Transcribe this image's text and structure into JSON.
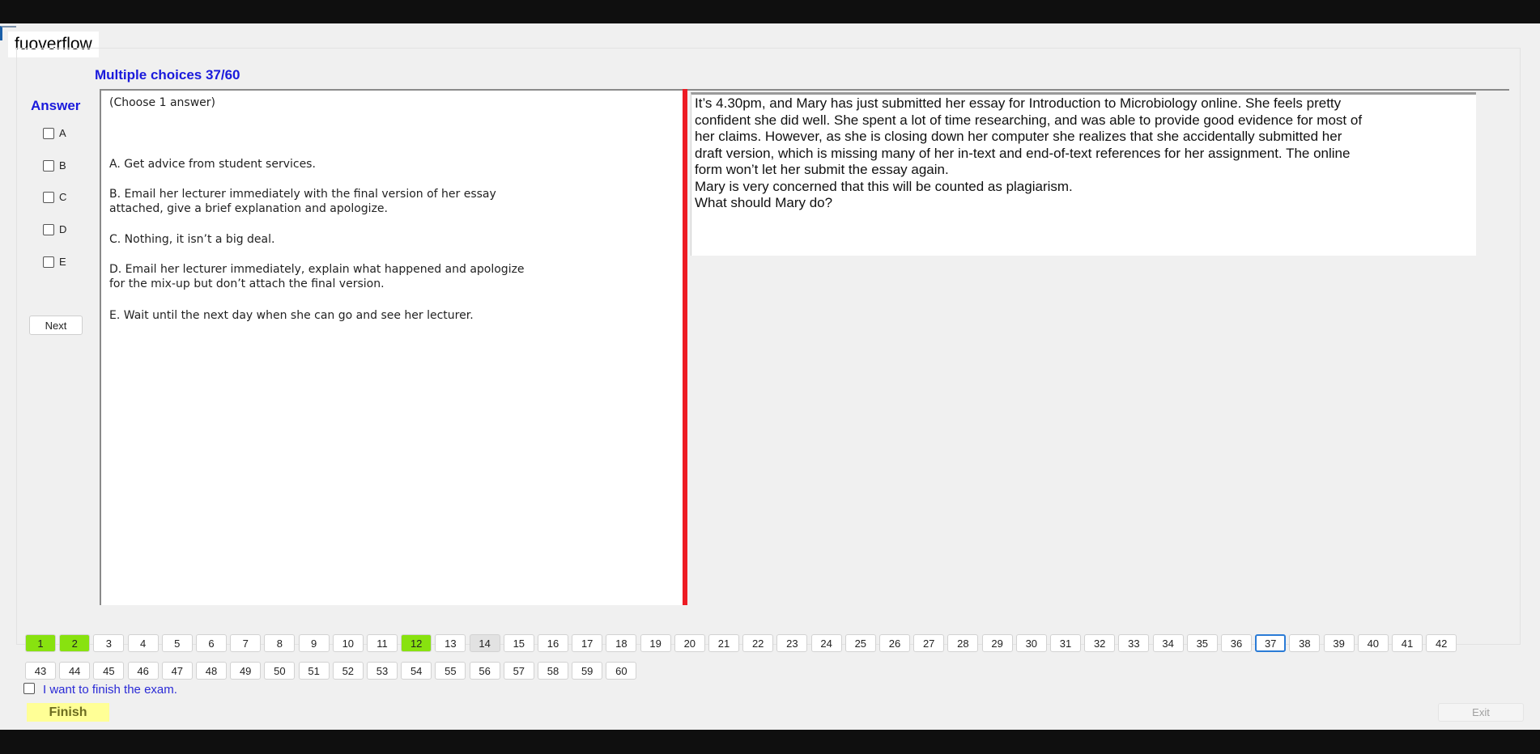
{
  "window": {
    "title": "fuoverflow"
  },
  "header": {
    "multiple_choices": "Multiple choices 37/60"
  },
  "answer_panel": {
    "label": "Answer",
    "options": [
      "A",
      "B",
      "C",
      "D",
      "E"
    ],
    "next_label": "Next"
  },
  "choices": {
    "instruction": "(Choose 1 answer)",
    "lines": [
      "A.  Get advice from student services.",
      "B.  Email her lecturer immediately with the final version of her essay",
      "attached, give a brief explanation and apologize.",
      "C.  Nothing, it isn’t a big deal.",
      "D.  Email her lecturer immediately, explain what happened and apologize",
      "for the mix-up but don’t attach the final version.",
      "E.  Wait until the next day when she can go and see her lecturer."
    ]
  },
  "question": {
    "lines": [
      "It’s 4.30pm, and Mary has just submitted her essay for Introduction to Microbiology online. She feels pretty",
      "confident she did well. She spent a lot of time researching, and was able to provide good evidence for most of",
      "her claims. However, as she is closing down her computer she realizes that she accidentally submitted her",
      "draft version, which is missing many of her in-text and end-of-text references for her assignment. The online",
      "form won’t let her submit the essay again.",
      "Mary is very concerned that this will be counted as plagiarism.",
      "What should Mary do?"
    ]
  },
  "navigation": {
    "total": 60,
    "current": 37,
    "answered": [
      1,
      2,
      12
    ],
    "visited": [
      14
    ]
  },
  "footer": {
    "finish_checkbox_label": "I want to finish the exam.",
    "finish_label": "Finish",
    "exit_label": "Exit"
  },
  "colors": {
    "accent_blue": "#1a1adc",
    "answered_green": "#88e20f",
    "divider_red": "#ed1c24",
    "finish_yellow": "#ffff96",
    "current_border": "#2a7bd6"
  }
}
